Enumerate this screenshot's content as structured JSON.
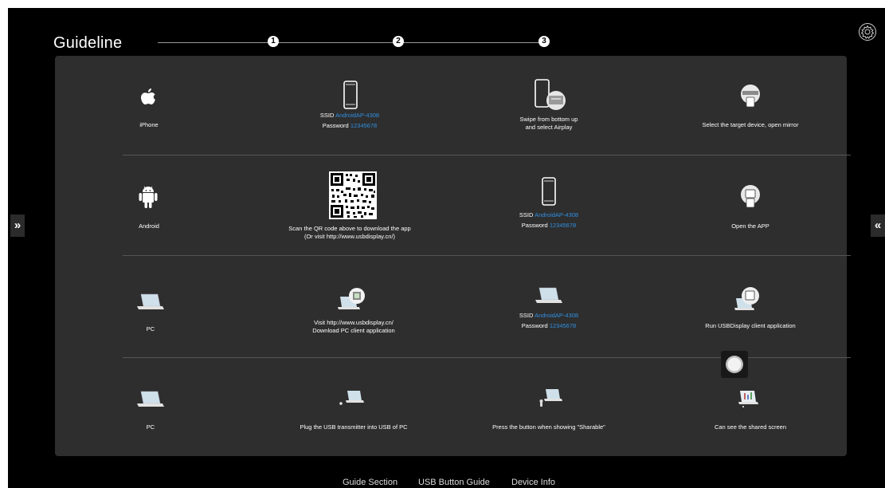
{
  "header": {
    "title": "Guideline",
    "steps": [
      "1",
      "2",
      "3"
    ]
  },
  "rows": [
    {
      "device": "iPhone",
      "step1": {
        "ssid_label": "SSID",
        "ssid_value": "AndroidAP-4308",
        "password_label": "Password",
        "password_value": "12345678"
      },
      "step2": {
        "line1": "Swipe from bottom up",
        "line2": "and select Airplay"
      },
      "step3": {
        "text": "Select the target device, open mirror"
      }
    },
    {
      "device": "Android",
      "step1": {
        "line1": "Scan the QR code above to download the app",
        "line2": "(Or visit http://www.usbdisplay.cn/)"
      },
      "step2": {
        "ssid_label": "SSID",
        "ssid_value": "AndroidAP-4308",
        "password_label": "Password",
        "password_value": "12345678"
      },
      "step3": {
        "text": "Open the APP"
      }
    },
    {
      "device": "PC",
      "step1": {
        "line1": "Visit http://www.usbdisplay.cn/",
        "line2": "Download PC client application"
      },
      "step2": {
        "ssid_label": "SSID",
        "ssid_value": "AndroidAP-4308",
        "password_label": "Password",
        "password_value": "12345678"
      },
      "step3": {
        "text": "Run USBDisplay client application"
      }
    },
    {
      "device": "PC",
      "step1": {
        "text": "Plug the USB transmitter into USB of PC"
      },
      "step2": {
        "text": "Press the button when showing \"Sharable\""
      },
      "step3": {
        "text": "Can see the shared screen"
      }
    }
  ],
  "side": {
    "left": "»",
    "right": "«"
  },
  "bottom_tabs": [
    "Guide Section",
    "USB Button Guide",
    "Device Info"
  ],
  "icons": {
    "settings": "gear-icon",
    "apple": "apple-icon",
    "android": "android-icon",
    "phone": "phone-icon",
    "laptop": "laptop-icon",
    "qr": "qr-code-icon"
  },
  "colors": {
    "accent": "#2f8fe0",
    "panel": "#2e2e2e",
    "background": "#000000"
  }
}
